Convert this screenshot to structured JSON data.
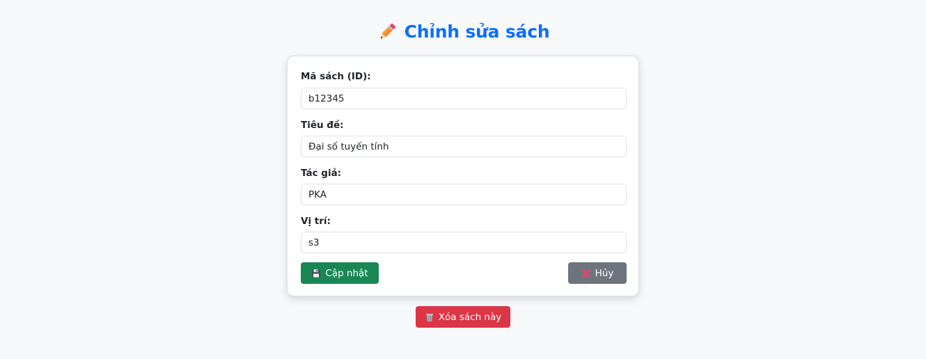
{
  "header": {
    "title": "Chỉnh sửa sách",
    "icon": "pencil-icon"
  },
  "form": {
    "fields": [
      {
        "label": "Mã sách (ID):",
        "value": "b12345"
      },
      {
        "label": "Tiêu đề:",
        "value": "Đại số tuyến tính"
      },
      {
        "label": "Tác giả:",
        "value": "PKA"
      },
      {
        "label": "Vị trí:",
        "value": "s3"
      }
    ],
    "update_label": "Cập nhật",
    "update_icon": "floppy-disk-icon",
    "cancel_label": "Hủy",
    "cancel_icon": "cross-mark-icon"
  },
  "delete": {
    "label": "Xóa sách này",
    "icon": "wastebasket-icon"
  },
  "colors": {
    "title": "#0d6efd",
    "update": "#198754",
    "cancel": "#6c757d",
    "delete": "#dc3545",
    "background": "#f8f9fa"
  }
}
